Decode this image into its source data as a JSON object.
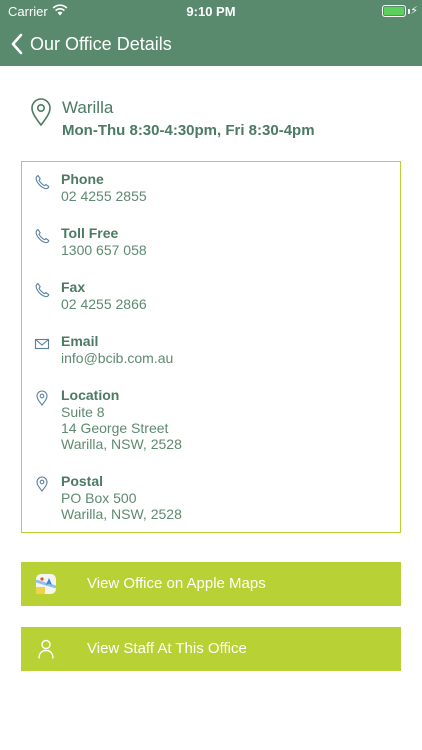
{
  "status_bar": {
    "carrier": "Carrier",
    "time": "9:10 PM"
  },
  "nav": {
    "back_icon": "chevron-left-icon",
    "title": "Our Office Details"
  },
  "office": {
    "name": "Warilla",
    "hours": "Mon-Thu 8:30-4:30pm, Fri 8:30-4pm"
  },
  "details": {
    "phone": {
      "label": "Phone",
      "value": "02 4255 2855",
      "icon": "phone-icon"
    },
    "toll_free": {
      "label": "Toll Free",
      "value": "1300 657 058",
      "icon": "phone-icon"
    },
    "fax": {
      "label": "Fax",
      "value": "02 4255 2866",
      "icon": "phone-icon"
    },
    "email": {
      "label": "Email",
      "value": "info@bcib.com.au",
      "icon": "envelope-icon"
    },
    "location": {
      "label": "Location",
      "lines": [
        "Suite 8",
        "14 George Street",
        "Warilla, NSW, 2528"
      ],
      "icon": "location-pin-icon"
    },
    "postal": {
      "label": "Postal",
      "lines": [
        "PO Box 500",
        "Warilla, NSW, 2528"
      ],
      "icon": "location-pin-icon"
    }
  },
  "actions": {
    "maps": {
      "label": "View Office on Apple Maps",
      "icon": "apple-maps-icon"
    },
    "staff": {
      "label": "View Staff At This Office",
      "icon": "person-icon"
    }
  },
  "colors": {
    "header_bg": "#5a8a6e",
    "accent_lime": "#b8d236",
    "text_green": "#4c7a63",
    "battery_green": "#5dd05a"
  }
}
